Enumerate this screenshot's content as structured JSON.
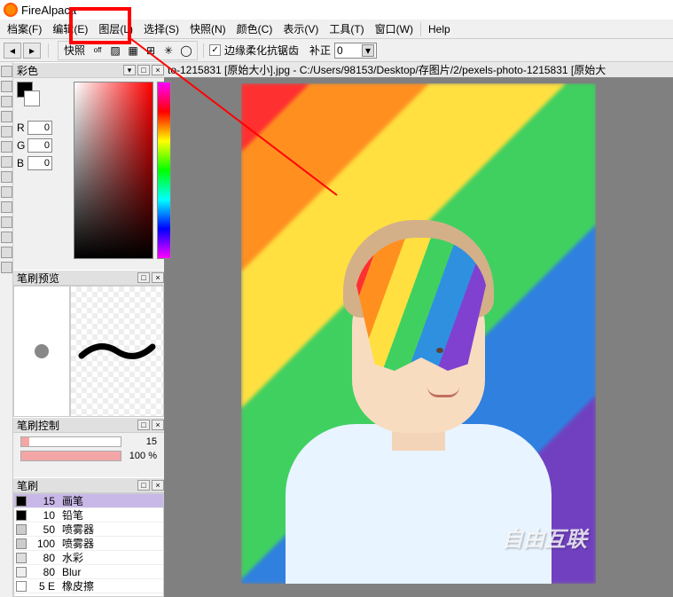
{
  "app": {
    "title": "FireAlpaca"
  },
  "menu": {
    "file": "档案(F)",
    "edit": "编辑(E)",
    "layer": "图层(L)",
    "select": "选择(S)",
    "snap": "快照(N)",
    "color": "颜色(C)",
    "view": "表示(V)",
    "tool": "工具(T)",
    "window": "窗口(W)",
    "help": "Help"
  },
  "toolbar": {
    "snap_label": "快照",
    "antialiasing_label": "边缘柔化抗锯齿",
    "correction_label": "补正",
    "correction_value": "0"
  },
  "panels": {
    "color_title": "彩色",
    "brush_preview_title": "笔刷预览",
    "brush_control_title": "笔刷控制",
    "brush_list_title": "笔刷"
  },
  "color": {
    "r_label": "R",
    "r_value": "0",
    "g_label": "G",
    "g_value": "0",
    "b_label": "B",
    "b_value": "0"
  },
  "brush_control": {
    "size_value": "15",
    "opacity_value": "100 %"
  },
  "brushes": [
    {
      "size": "15",
      "name": "画笔",
      "sw": "#000000",
      "selected": true
    },
    {
      "size": "10",
      "name": "铅笔",
      "sw": "#000000",
      "selected": false
    },
    {
      "size": "50",
      "name": "喷雾器",
      "sw": "#cccccc",
      "selected": false
    },
    {
      "size": "100",
      "name": "喷雾器",
      "sw": "#cccccc",
      "selected": false
    },
    {
      "size": "80",
      "name": "水彩",
      "sw": "#dddddd",
      "selected": false
    },
    {
      "size": "80",
      "name": "Blur",
      "sw": "#eeeeee",
      "selected": false
    },
    {
      "size": "5 E",
      "name": "橡皮擦",
      "sw": "#ffffff",
      "selected": false
    }
  ],
  "document": {
    "tab_text": "to-1215831 [原始大小].jpg - C:/Users/98153/Desktop/存图片/2/pexels-photo-1215831 [原始大"
  },
  "watermark": "自由互联"
}
